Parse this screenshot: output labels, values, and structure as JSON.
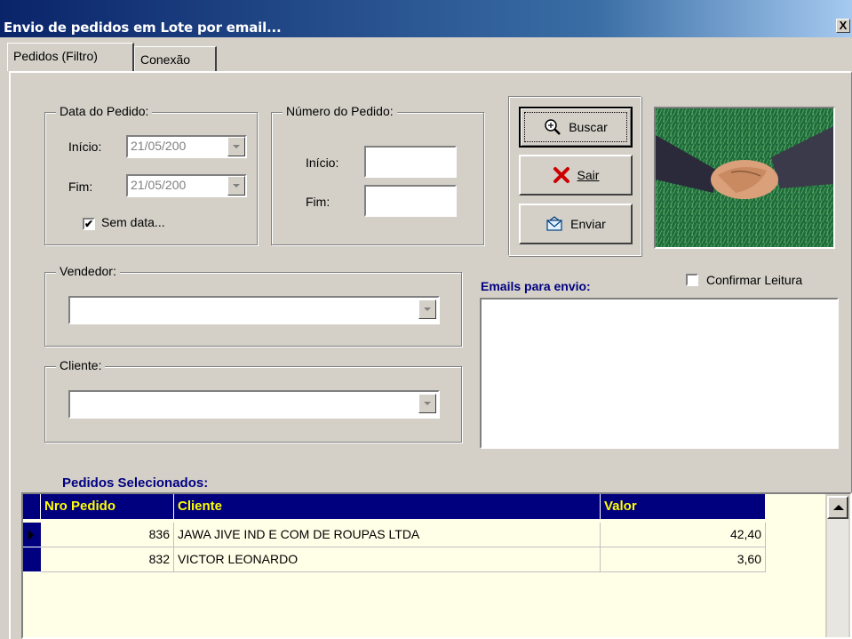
{
  "window": {
    "title": "Envio de pedidos em Lote por email...",
    "close_label": "X"
  },
  "tabs": [
    {
      "label": "Pedidos (Filtro)"
    },
    {
      "label": "Conexão"
    }
  ],
  "date_group": {
    "legend": "Data do Pedido:",
    "start_label": "Início:",
    "start_value": "21/05/200",
    "end_label": "Fim:",
    "end_value": "21/05/200",
    "no_date_label": "Sem data...",
    "no_date_checked": "✔"
  },
  "number_group": {
    "legend": "Número do Pedido:",
    "start_label": "Início:",
    "end_label": "Fim:"
  },
  "buttons": {
    "search": "Buscar",
    "exit": "Sair",
    "send": "Enviar"
  },
  "seller_group": {
    "legend": "Vendedor:"
  },
  "client_group": {
    "legend": "Cliente:"
  },
  "emails": {
    "label": "Emails para envio:",
    "confirm_label": "Confirmar Leitura"
  },
  "grid": {
    "title": "Pedidos Selecionados:",
    "columns": [
      "Nro Pedido",
      "Cliente",
      "Valor"
    ],
    "rows": [
      {
        "nro": "836",
        "cliente": "JAWA JIVE IND E COM DE ROUPAS LTDA",
        "valor": "42,40"
      },
      {
        "nro": "832",
        "cliente": "VICTOR LEONARDO",
        "valor": "3,60"
      }
    ]
  },
  "colors": {
    "title_bar": "#0a246a",
    "grid_header": "#00007f",
    "grid_header_text": "#ffff00",
    "grid_bg": "#ffffe8",
    "label_blue": "#000080"
  }
}
